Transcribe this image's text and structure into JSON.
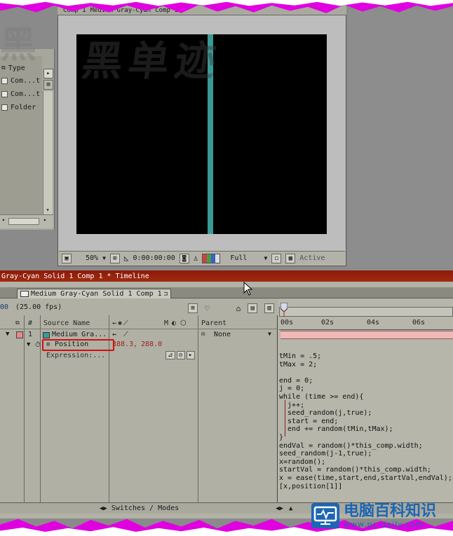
{
  "project_panel": {
    "header": "Type",
    "items": [
      {
        "label": "Com...t"
      },
      {
        "label": "Com...t"
      },
      {
        "label": "Folder"
      }
    ]
  },
  "comp_window": {
    "tabs": [
      "Comp 1",
      "Medium Gray-Cyan",
      "Comp 1"
    ],
    "footer": {
      "zoom": "50%",
      "timecode": "0:00:00:00",
      "resolution": "Full",
      "view": "Active"
    },
    "layer_color": "#3a9a96"
  },
  "timeline": {
    "title": "Gray-Cyan Solid 1 Comp 1 * Timeline",
    "tab_label": "Medium Gray-Cyan Solid 1 Comp 1",
    "tab_close": "⊐",
    "time_left": "00",
    "fps": "(25.00 fps)",
    "columns": {
      "number": "#",
      "source_name": "Source Name",
      "switches_letter": "M",
      "parent": "Parent"
    },
    "ruler_ticks": [
      "00s",
      "02s",
      "04s",
      "06s"
    ],
    "layer": {
      "number": "1",
      "name": "Medium Gra...",
      "parent": "None",
      "color": "#e48a8a"
    },
    "property": {
      "name": "Position",
      "value_x": "388.3",
      "separator": ",",
      "value_y": "288.0"
    },
    "expression_label": "Expression:...",
    "footer_label": "Switches / Modes",
    "expression_code": [
      "tMin = .5;",
      "tMax = 2;",
      "",
      "end = 0;",
      "j = 0;",
      "while (time >= end){",
      "  j++;",
      "  seed_random(j,true);",
      "  start = end;",
      "  end += random(tMin,tMax);",
      "}",
      "endVal = random()*this_comp.width;",
      "seed_random(j-1,true);",
      "x=random();",
      "startVal = random()*this_comp.width;",
      "x = ease(time,start,end,startVal,endVal);",
      "[x,position[1]]"
    ]
  },
  "logo": {
    "name": "电脑百科知识",
    "url": "www.pc-daily.com"
  },
  "watermark": "黑单迹"
}
